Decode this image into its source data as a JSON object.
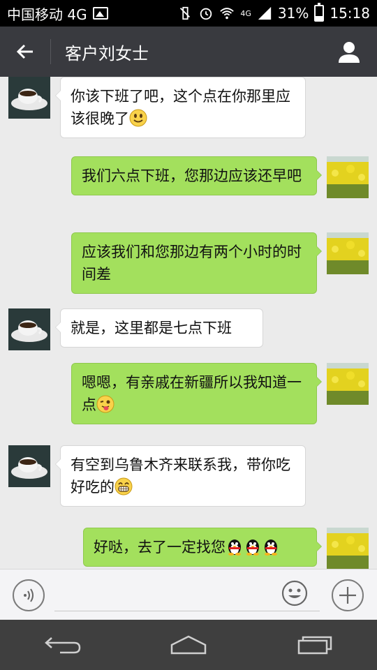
{
  "status_bar": {
    "carrier": "中国移动 4G",
    "network": "4G",
    "battery": "31%",
    "battery_level": 0.31,
    "time": "15:18"
  },
  "header": {
    "title": "客户刘女士",
    "back_icon": "back-arrow-icon",
    "profile_icon": "person-icon",
    "bg_color": "#393a3f"
  },
  "messages": [
    {
      "side": "in",
      "text": "你该下班了吧，这个点在你那里应该很晚了",
      "emoji": [
        "smile-emoji"
      ]
    },
    {
      "side": "out",
      "text": "我们六点下班，您那边应该还早吧",
      "emoji": []
    },
    {
      "side": "out",
      "text": "应该我们和您那边有两个小时的时间差",
      "emoji": []
    },
    {
      "side": "in",
      "text": "就是，这里都是七点下班",
      "emoji": []
    },
    {
      "side": "out",
      "text": "嗯嗯，有亲戚在新疆所以我知道一点",
      "emoji": [
        "tongue-wink-emoji"
      ]
    },
    {
      "side": "in",
      "text": "有空到乌鲁木齐来联系我，带你吃好吃的",
      "emoji": [
        "grin-emoji"
      ]
    },
    {
      "side": "out",
      "text": "好哒，去了一定找您",
      "emoji": [
        "penguin-emoji",
        "penguin-emoji",
        "penguin-emoji"
      ]
    }
  ],
  "colors": {
    "outgoing_bubble": "#a3e05d",
    "incoming_bubble": "#ffffff",
    "chat_bg": "#ebebeb"
  },
  "input_bar": {
    "voice_icon": "voice-icon",
    "emoji_icon": "emoji-icon",
    "plus_icon": "plus-icon",
    "placeholder": ""
  },
  "nav_bar": {
    "back_icon": "nav-back-icon",
    "home_icon": "nav-home-icon",
    "recents_icon": "nav-recents-icon"
  }
}
